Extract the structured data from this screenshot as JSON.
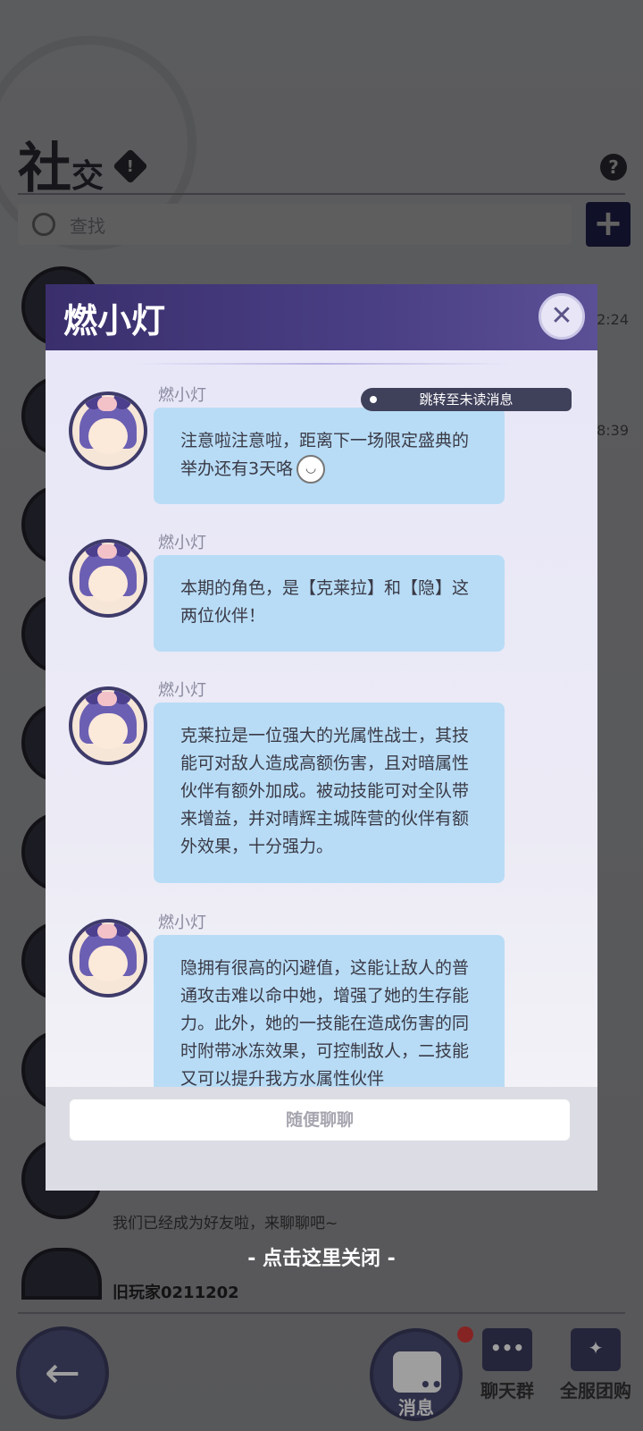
{
  "background": {
    "title_main": "社",
    "title_small": "交",
    "warn_icon": "exclamation-icon",
    "help_icon": "question-icon",
    "search_placeholder": "查找",
    "add_icon": "plus-icon",
    "times": [
      "2:24",
      "8:39"
    ],
    "last_message": "我们已经成为好友啦，来聊聊吧~",
    "second_name": "旧玩家0211202"
  },
  "dialog": {
    "title": "燃小灯",
    "close_icon": "close-icon",
    "jump_label": "跳转至未读消息",
    "messages": [
      {
        "sender": "燃小灯",
        "text": "注意啦注意啦，距离下一场限定盛典的举办还有3天咯",
        "emoji": "smile-emoji"
      },
      {
        "sender": "燃小灯",
        "text": "本期的角色，是【克莱拉】和【隐】这两位伙伴！"
      },
      {
        "sender": "燃小灯",
        "text": "克莱拉是一位强大的光属性战士，其技能可对敌人造成高额伤害，且对暗属性伙伴有额外加成。被动技能可对全队带来增益，并对晴辉主城阵营的伙伴有额外效果，十分强力。"
      },
      {
        "sender": "燃小灯",
        "text": "隐拥有很高的闪避值，这能让敌人的普通攻击难以命中她，增强了她的生存能力。此外，她的一技能在造成伤害的同时附带冰冻效果，可控制敌人，二技能又可以提升我方水属性伙伴"
      }
    ],
    "input_placeholder": "随便聊聊"
  },
  "close_hint": "- 点击这里关闭 -",
  "nav": {
    "back_icon": "back-arrow-icon",
    "messages_label": "消息",
    "chat_group_label": "聊天群",
    "server_group_label": "全服团购"
  }
}
